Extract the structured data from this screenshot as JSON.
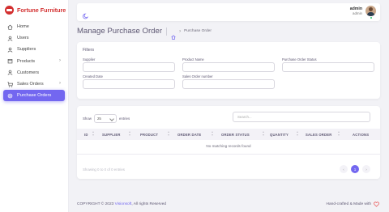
{
  "brand": {
    "name": "Fortune Furniture",
    "color": "#d32f2f"
  },
  "sidebar": {
    "items": [
      {
        "label": "Home",
        "icon": "home-icon"
      },
      {
        "label": "Users",
        "icon": "user-icon"
      },
      {
        "label": "Suppliers",
        "icon": "user-icon"
      },
      {
        "label": "Products",
        "icon": "box-icon",
        "has_submenu": true
      },
      {
        "label": "Customers",
        "icon": "user-icon"
      },
      {
        "label": "Sales Orders",
        "icon": "cart-icon",
        "has_submenu": true
      },
      {
        "label": "Purchase Orders",
        "icon": "settings-icon",
        "active": true
      }
    ],
    "accent": "#7367f0"
  },
  "navbar": {
    "theme_icon": "moon-icon",
    "user_name": "admin",
    "user_role": "admin"
  },
  "header": {
    "title": "Manage Purchase Order",
    "breadcrumb": "Purchase Order"
  },
  "filters": {
    "title": "Filters",
    "fields": [
      {
        "label": "Supplier",
        "value": ""
      },
      {
        "label": "Product Name",
        "value": ""
      },
      {
        "label": "Purchase Order Status",
        "value": ""
      },
      {
        "label": "Created Date",
        "value": ""
      },
      {
        "label": "Sales Order number",
        "value": ""
      }
    ]
  },
  "table": {
    "show_label": "Show",
    "page_size": "25",
    "entries_label": "entries",
    "search_placeholder": "Search...",
    "columns": [
      "ID",
      "SUPPLIER",
      "PRODUCT",
      "ORDER DATE",
      "ORDER STATUS",
      "QUANTITY",
      "SALES ORDER",
      "ACTIONS"
    ],
    "empty_message": "No matching records found",
    "showing_text": "Showing 0 to 0 of 0 entries",
    "pagination": {
      "prev": "‹",
      "current": "1",
      "next": "›"
    }
  },
  "footer": {
    "copyright": "COPYRIGHT © 2023",
    "company": "Visionsoft",
    "rights": ", All rights Reserved",
    "made_with": "Hand-crafted & Made with"
  }
}
